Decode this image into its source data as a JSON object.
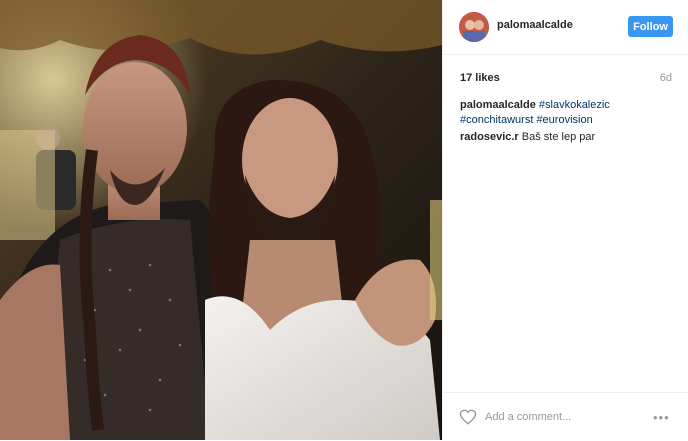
{
  "post": {
    "photo_icon": "photo-portrait"
  },
  "header": {
    "username": "palomaalcalde",
    "follow_label": "Follow"
  },
  "stats": {
    "likes": "17 likes",
    "time": "6d"
  },
  "caption": {
    "username": "palomaalcalde",
    "tags": [
      "#slavkokalezic",
      "#conchitawurst",
      "#eurovision"
    ]
  },
  "comments": [
    {
      "username": "radosevic.r",
      "text": "Baš ste lep par"
    }
  ],
  "footer": {
    "add_comment_placeholder": "Add a comment...",
    "heart_icon": "heart-outline-icon",
    "more_icon": "ellipsis-icon",
    "more_label": "•••"
  },
  "colors": {
    "accent": "#3897f0",
    "link": "#003569",
    "muted": "#999999"
  }
}
